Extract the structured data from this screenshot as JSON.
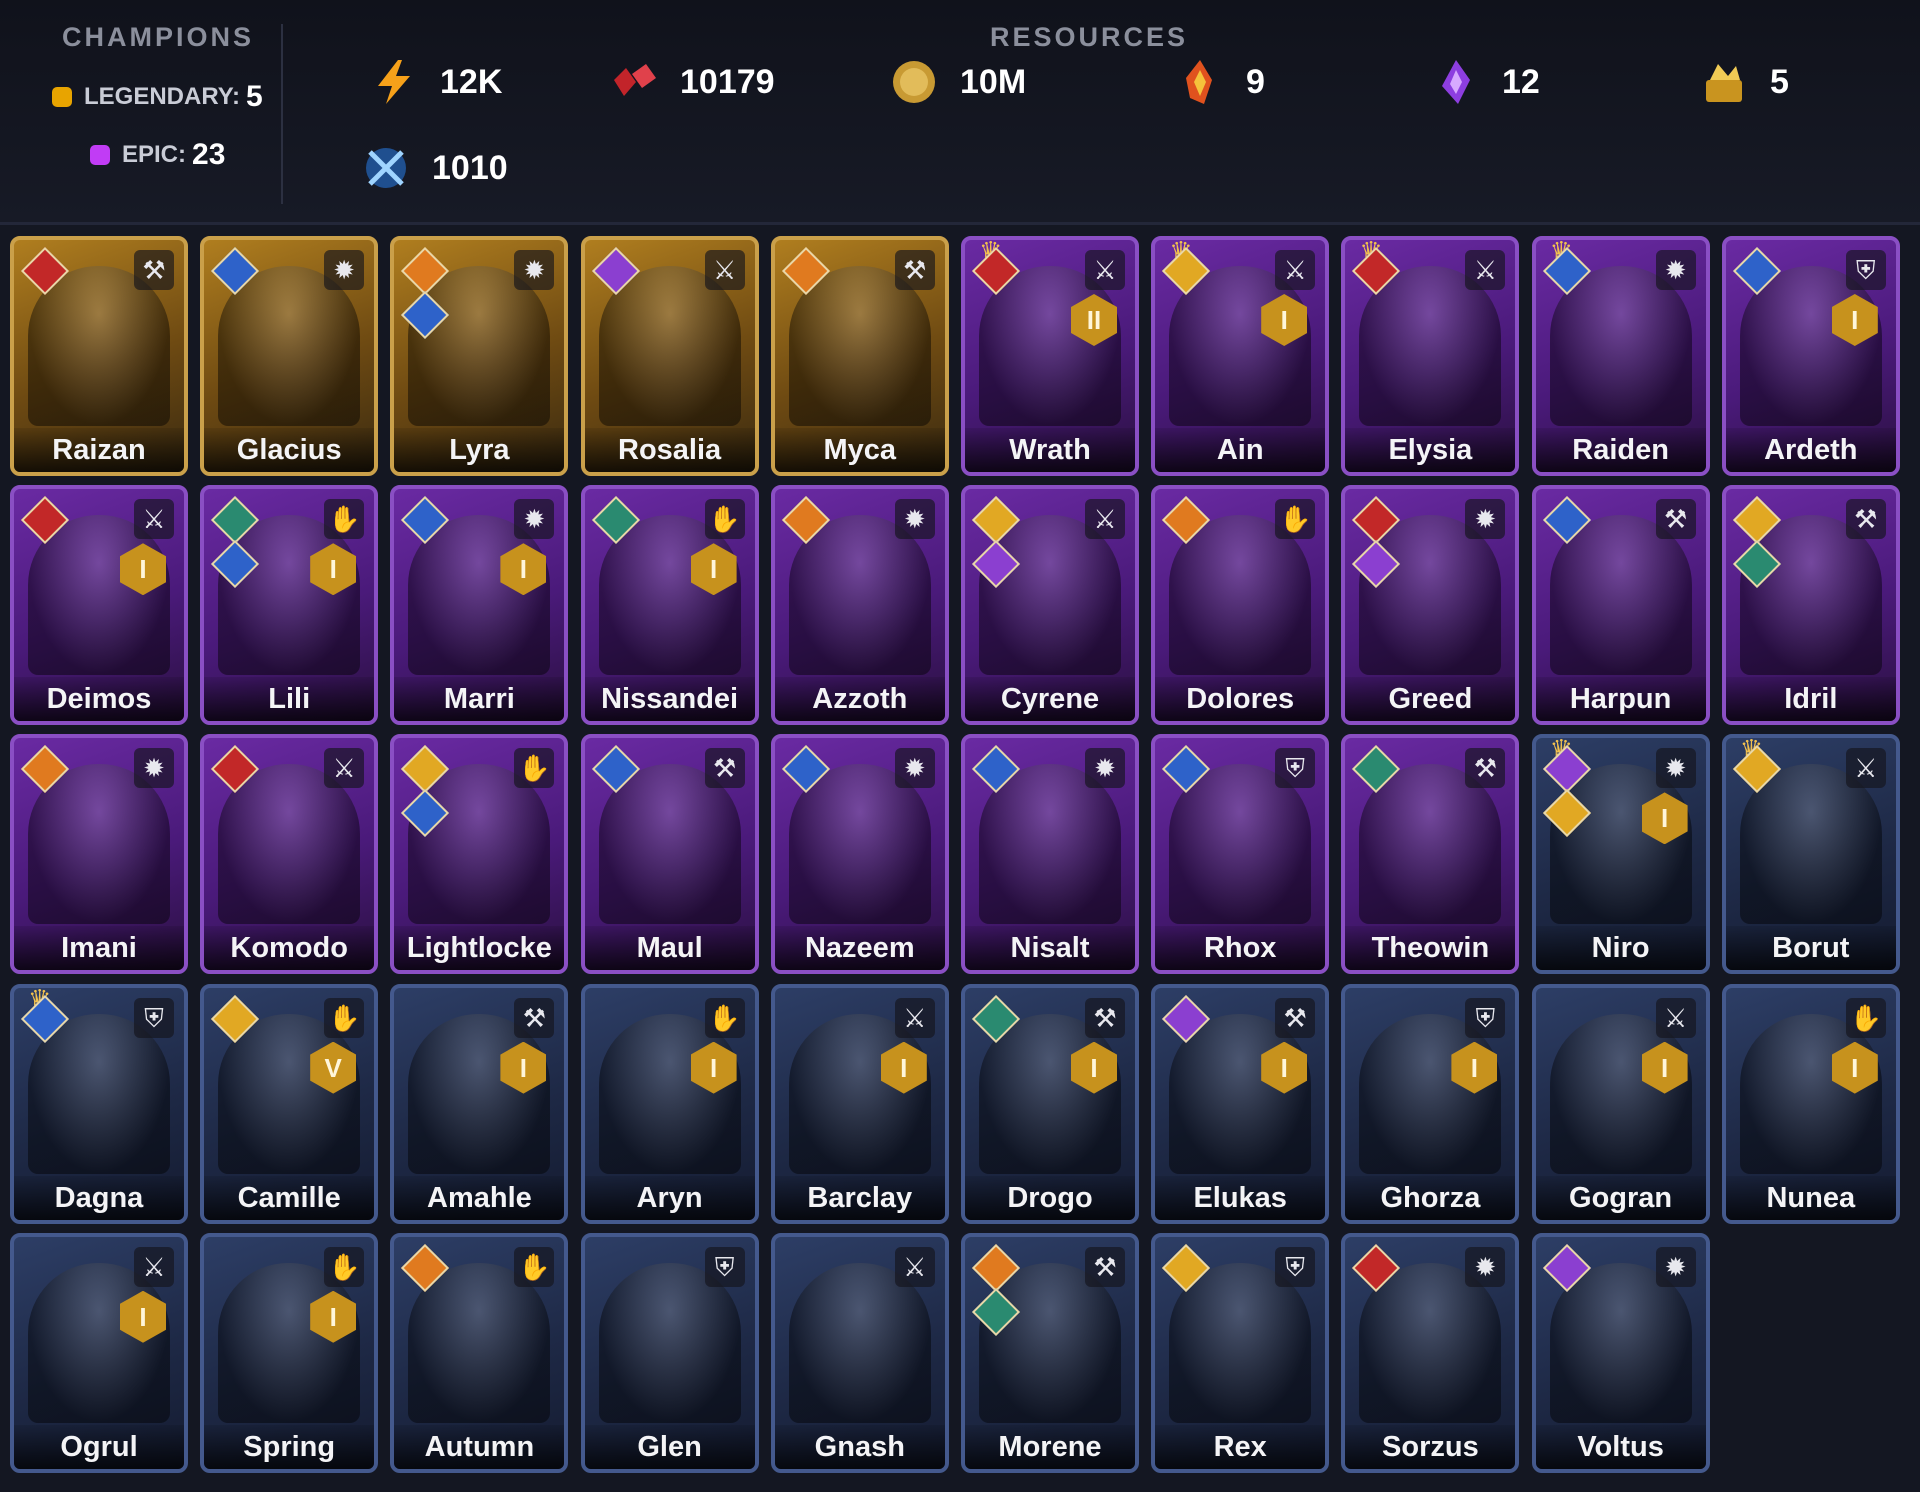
{
  "header": {
    "champions": {
      "title": "CHAMPIONS",
      "legendary": {
        "label": "LEGENDARY:",
        "count": "5",
        "color": "#e8a400"
      },
      "epic": {
        "label": "EPIC:",
        "count": "23",
        "color": "#c13cf5"
      }
    },
    "resources": {
      "title": "RESOURCES",
      "items": [
        {
          "icon": "energy-bolt-icon",
          "value": "12K"
        },
        {
          "icon": "gem-icon",
          "value": "10179"
        },
        {
          "icon": "gold-coin-icon",
          "value": "10M"
        },
        {
          "icon": "fire-shard-icon",
          "value": "9"
        },
        {
          "icon": "void-shard-icon",
          "value": "12"
        },
        {
          "icon": "treasure-pile-icon",
          "value": "5"
        },
        {
          "icon": "crossed-swords-icon",
          "value": "1010"
        }
      ]
    }
  },
  "champions": [
    {
      "name": "Raizan",
      "rarity": "legendary",
      "affinities": [
        "red"
      ],
      "role": "axe-icon"
    },
    {
      "name": "Glacius",
      "rarity": "legendary",
      "affinities": [
        "blue"
      ],
      "role": "mace-icon"
    },
    {
      "name": "Lyra",
      "rarity": "legendary",
      "affinities": [
        "orange",
        "blue"
      ],
      "role": "mace-icon"
    },
    {
      "name": "Rosalia",
      "rarity": "legendary",
      "affinities": [
        "violet"
      ],
      "role": "sword-icon"
    },
    {
      "name": "Myca",
      "rarity": "legendary",
      "affinities": [
        "orange"
      ],
      "role": "axe-icon"
    },
    {
      "name": "Wrath",
      "rarity": "epic",
      "affinities": [
        "red"
      ],
      "role": "sword-icon",
      "crown": true,
      "rank": "II"
    },
    {
      "name": "Ain",
      "rarity": "epic",
      "affinities": [
        "gold"
      ],
      "role": "sword-icon",
      "crown": true,
      "rank": "I"
    },
    {
      "name": "Elysia",
      "rarity": "epic",
      "affinities": [
        "red"
      ],
      "role": "sword-icon",
      "crown": true
    },
    {
      "name": "Raiden",
      "rarity": "epic",
      "affinities": [
        "blue"
      ],
      "role": "mace-icon",
      "crown": true
    },
    {
      "name": "Ardeth",
      "rarity": "epic",
      "affinities": [
        "blue"
      ],
      "role": "shield-icon",
      "rank": "I"
    },
    {
      "name": "Deimos",
      "rarity": "epic",
      "affinities": [
        "red"
      ],
      "role": "sword-icon",
      "rank": "I"
    },
    {
      "name": "Lili",
      "rarity": "epic",
      "affinities": [
        "teal",
        "blue"
      ],
      "role": "hands-icon",
      "rank": "I"
    },
    {
      "name": "Marri",
      "rarity": "epic",
      "affinities": [
        "blue"
      ],
      "role": "mace-icon",
      "rank": "I"
    },
    {
      "name": "Nissandei",
      "rarity": "epic",
      "affinities": [
        "teal"
      ],
      "role": "hands-icon",
      "rank": "I"
    },
    {
      "name": "Azzoth",
      "rarity": "epic",
      "affinities": [
        "orange"
      ],
      "role": "mace-icon"
    },
    {
      "name": "Cyrene",
      "rarity": "epic",
      "affinities": [
        "gold",
        "violet"
      ],
      "role": "sword-icon"
    },
    {
      "name": "Dolores",
      "rarity": "epic",
      "affinities": [
        "orange"
      ],
      "role": "hands-icon"
    },
    {
      "name": "Greed",
      "rarity": "epic",
      "affinities": [
        "red",
        "violet"
      ],
      "role": "mace-icon"
    },
    {
      "name": "Harpun",
      "rarity": "epic",
      "affinities": [
        "blue"
      ],
      "role": "axe-icon"
    },
    {
      "name": "Idril",
      "rarity": "epic",
      "affinities": [
        "gold",
        "teal"
      ],
      "role": "axe-icon"
    },
    {
      "name": "Imani",
      "rarity": "epic",
      "affinities": [
        "orange"
      ],
      "role": "mace-icon"
    },
    {
      "name": "Komodo",
      "rarity": "epic",
      "affinities": [
        "red"
      ],
      "role": "sword-icon"
    },
    {
      "name": "Lightlocke",
      "rarity": "epic",
      "affinities": [
        "gold",
        "blue"
      ],
      "role": "hands-icon"
    },
    {
      "name": "Maul",
      "rarity": "epic",
      "affinities": [
        "blue"
      ],
      "role": "axe-icon"
    },
    {
      "name": "Nazeem",
      "rarity": "epic",
      "affinities": [
        "blue"
      ],
      "role": "mace-icon"
    },
    {
      "name": "Nisalt",
      "rarity": "epic",
      "affinities": [
        "blue"
      ],
      "role": "mace-icon"
    },
    {
      "name": "Rhox",
      "rarity": "epic",
      "affinities": [
        "blue"
      ],
      "role": "shield-icon"
    },
    {
      "name": "Theowin",
      "rarity": "epic",
      "affinities": [
        "teal"
      ],
      "role": "axe-icon"
    },
    {
      "name": "Niro",
      "rarity": "rare",
      "affinities": [
        "violet",
        "gold"
      ],
      "role": "mace-icon",
      "crown": true,
      "rank": "I"
    },
    {
      "name": "Borut",
      "rarity": "rare",
      "affinities": [
        "gold"
      ],
      "role": "sword-icon",
      "crown": true
    },
    {
      "name": "Dagna",
      "rarity": "rare",
      "affinities": [
        "blue"
      ],
      "role": "shield-icon",
      "crown": true
    },
    {
      "name": "Camille",
      "rarity": "rare",
      "affinities": [
        "gold"
      ],
      "role": "hands-icon",
      "rank": "V"
    },
    {
      "name": "Amahle",
      "rarity": "rare",
      "affinities": [],
      "role": "axe-icon",
      "rank": "I"
    },
    {
      "name": "Aryn",
      "rarity": "rare",
      "affinities": [],
      "role": "hands-icon",
      "rank": "I"
    },
    {
      "name": "Barclay",
      "rarity": "rare",
      "affinities": [],
      "role": "sword-icon",
      "rank": "I"
    },
    {
      "name": "Drogo",
      "rarity": "rare",
      "affinities": [
        "teal"
      ],
      "role": "axe-icon",
      "rank": "I"
    },
    {
      "name": "Elukas",
      "rarity": "rare",
      "affinities": [
        "violet"
      ],
      "role": "axe-icon",
      "rank": "I"
    },
    {
      "name": "Ghorza",
      "rarity": "rare",
      "affinities": [],
      "role": "shield-icon",
      "rank": "I"
    },
    {
      "name": "Gogran",
      "rarity": "rare",
      "affinities": [],
      "role": "sword-icon",
      "rank": "I"
    },
    {
      "name": "Nunea",
      "rarity": "rare",
      "affinities": [],
      "role": "hands-icon",
      "rank": "I"
    },
    {
      "name": "Ogrul",
      "rarity": "rare",
      "affinities": [],
      "role": "sword-icon",
      "rank": "I"
    },
    {
      "name": "Spring",
      "rarity": "rare",
      "affinities": [],
      "role": "hands-icon",
      "rank": "I"
    },
    {
      "name": "Autumn",
      "rarity": "rare",
      "affinities": [
        "orange"
      ],
      "role": "hands-icon"
    },
    {
      "name": "Glen",
      "rarity": "rare",
      "affinities": [],
      "role": "shield-icon"
    },
    {
      "name": "Gnash",
      "rarity": "rare",
      "affinities": [],
      "role": "sword-icon"
    },
    {
      "name": "Morene",
      "rarity": "rare",
      "affinities": [
        "orange",
        "teal"
      ],
      "role": "axe-icon"
    },
    {
      "name": "Rex",
      "rarity": "rare",
      "affinities": [
        "gold"
      ],
      "role": "shield-icon"
    },
    {
      "name": "Sorzus",
      "rarity": "rare",
      "affinities": [
        "red"
      ],
      "role": "mace-icon"
    },
    {
      "name": "Voltus",
      "rarity": "rare",
      "affinities": [
        "violet"
      ],
      "role": "mace-icon"
    }
  ]
}
